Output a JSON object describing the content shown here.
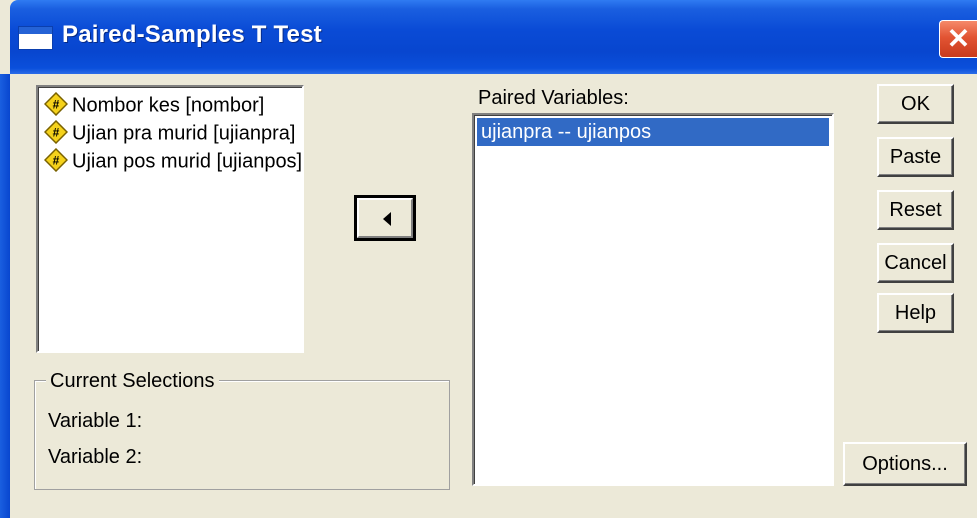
{
  "window": {
    "title": "Paired-Samples T Test",
    "close_glyph": "✕"
  },
  "source_list": {
    "items": [
      {
        "label": "Nombor kes [nombor]",
        "icon": "numeric-variable-icon"
      },
      {
        "label": "Ujian pra murid [ujianpra]",
        "icon": "numeric-variable-icon"
      },
      {
        "label": "Ujian pos murid [ujianpos]",
        "icon": "numeric-variable-icon"
      }
    ]
  },
  "current_selections": {
    "title": "Current Selections",
    "variable1_label": "Variable 1:",
    "variable2_label": "Variable 2:"
  },
  "move_button": {
    "icon": "left-arrow-icon"
  },
  "paired_variables": {
    "label": "Paired Variables:",
    "selected_pair": "ujianpra -- ujianpos"
  },
  "buttons": {
    "ok": "OK",
    "paste": "Paste",
    "reset": "Reset",
    "cancel": "Cancel",
    "help": "Help",
    "options": "Options..."
  },
  "colors": {
    "titlebar": "#0a4bd6",
    "selection": "#316ac5",
    "dialog_bg": "#ece9d8",
    "close": "#e25433"
  }
}
